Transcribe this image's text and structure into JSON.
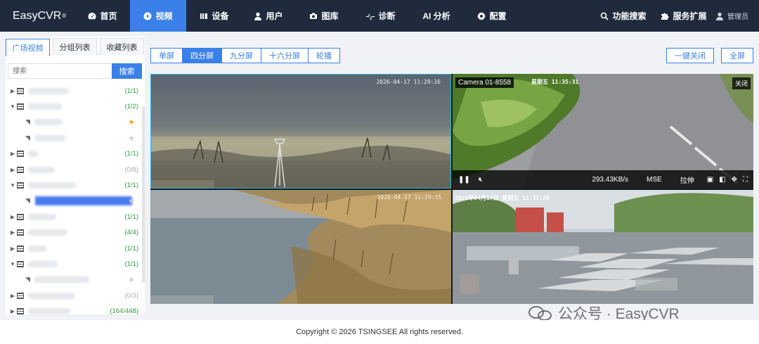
{
  "brand": {
    "name": "EasyCVR",
    "reg": "®"
  },
  "nav": [
    {
      "label": "首页",
      "icon": "dashboard-icon",
      "active": false
    },
    {
      "label": "视频",
      "icon": "play-circle-icon",
      "active": true
    },
    {
      "label": "设备",
      "icon": "device-icon",
      "active": false
    },
    {
      "label": "用户",
      "icon": "user-icon",
      "active": false
    },
    {
      "label": "图库",
      "icon": "gallery-icon",
      "active": false
    },
    {
      "label": "诊断",
      "icon": "pulse-icon",
      "active": false
    },
    {
      "label": "AI 分析",
      "icon": "",
      "active": false
    },
    {
      "label": "配置",
      "icon": "gear-icon",
      "active": false
    }
  ],
  "nav_right": {
    "search": "功能搜索",
    "extend": "服务扩展",
    "user": "管理员"
  },
  "sidebar": {
    "tabs": [
      "广场视频",
      "分组列表",
      "收藏列表"
    ],
    "search_placeholder": "搜索",
    "search_button": "搜索",
    "counts": [
      "(1/1)",
      "(1/2)",
      "(1/1)",
      "(0/8)",
      "(1/1)",
      "(1/1)",
      "(4/4)",
      "(1/1)",
      "(1/1)",
      "(0/3)",
      "(164/448)"
    ]
  },
  "toolbar": {
    "layouts": [
      "单屏",
      "四分屏",
      "九分屏",
      "十六分屏",
      "轮播"
    ],
    "active_layout": "四分屏",
    "close_all": "一键关闭",
    "fullscreen": "全屏"
  },
  "videos": {
    "v1_time": "2026-04-17  11:29:16",
    "v2_label": "Camera 01-8558",
    "v2_time": "星期五 11:35:31",
    "v2_close": "关闭",
    "v2_speed": "293.43KB/s",
    "v2_mode": "MSE",
    "v2_stretch": "拉伸",
    "v3_time": "2026-04-17  11:29:15",
    "v4_time": "2026年04月17日 星期五 11:35:26"
  },
  "footer": {
    "copyright": "Copyright © 2026 TSINGSEE All rights reserved."
  },
  "watermark": {
    "text": "公众号 · EasyCVR"
  },
  "colors": {
    "nav_bg": "#1f2b3d",
    "accent": "#3a80e8",
    "count_green": "#2e9a3e"
  }
}
